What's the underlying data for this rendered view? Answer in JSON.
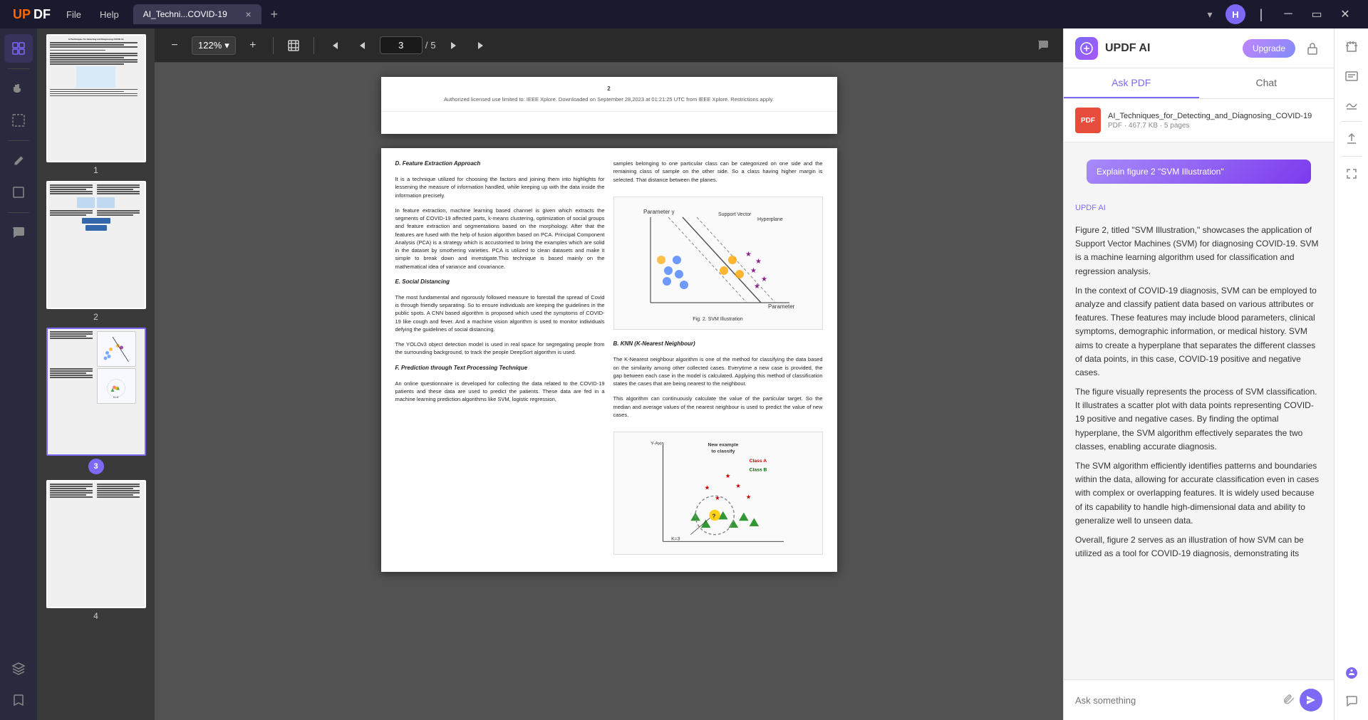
{
  "app": {
    "name": "UPDF",
    "logo_text": "UPDF"
  },
  "titlebar": {
    "file_menu": "File",
    "help_menu": "Help",
    "tab_title": "AI_Techni...COVID-19",
    "tab_close": "×",
    "tab_add": "+",
    "controls": {
      "dropdown": "▾",
      "user_avatar": "H",
      "minimize": "─",
      "maximize": "▭",
      "close": "✕"
    }
  },
  "toolbar": {
    "zoom_out": "−",
    "zoom_level": "122%",
    "zoom_dropdown": "▾",
    "zoom_in": "+",
    "fit_page": "⊡",
    "nav_first": "⏮",
    "nav_prev": "◀",
    "page_current": "3",
    "page_separator": "/",
    "page_total": "5",
    "nav_next": "▶",
    "nav_last": "⏭",
    "comment_icon": "💬"
  },
  "pdf": {
    "page2_header": "Authorized licensed use limited to: IEEE Xplore. Downloaded on September 28,2023 at 01:21:25 UTC from IEEE Xplore. Restrictions apply.",
    "page2_num": "2",
    "page3_sections": {
      "left_col": {
        "section_d_title": "D. Feature Extraction Approach",
        "section_d_para1": "It is a technique utilized for choosing the factors and joining them into highlights for lessening the measure of information handled, while keeping up with the data inside the information precisely.",
        "section_d_para2": "In feature extraction, machine learning based channel is given which extracts the segments of COVID-19 affected parts, k-means clustering, optimization of social groups and feature extraction and segmentations based on the morphology. After that the features are fused with the help of fusion algorithm based on PCA. Principal Component Analysis (PCA) is a strategy which is accustomed to bring the examples which are solid in the dataset by smothering varieties. PCA is utilized to clean datasets and make it simple to break down and investigate.This technique is based mainly on the mathematical idea of variance and covariance.",
        "section_e_title": "E. Social Distancing",
        "section_e_para1": "The most fundamental and rigorously followed measure to forestall the spread of Covid is through friendly separating. So to ensure individuals are keeping the guidelines in the public spots. A CNN based algorithm is proposed which used the symptoms of COVID-19 like cough and fever. And a machine vision algorithm is used to monitor individuals defying the guidelines of social distancing.",
        "section_e_para2": "The YOLOv3 object detection model is used in real space for segregating people from the surrounding background, to track the people DeepSort algorithm is used.",
        "section_f_title": "F. Prediction through Text Processing Technique",
        "section_f_para1": "An online questionnaire is developed for collecting the data related to the COVID-19 patients and these data are used to predict the patients. These data are fed in a machine learning prediction algorithms like SVM, logistic regression,"
      },
      "right_col": {
        "intro_para1": "samples belonging to one particular class can be categorized on one side and the remaining class of sample on the other side. So a class having higher margin is selected. That distance between the planes.",
        "fig2_caption": "Fig. 2. SVM Illustration",
        "section_b_title": "B. KNN (K-Nearest Neighbour)",
        "section_b_para1": "The K-Nearest neighbour algorithm is one of the method for classifying the data based on the similarity among other collected cases. Everytime a new case is provided, the gap between each case in the model is calculated. Applying this method of classification states the cases that are being nearest to the neighbour.",
        "section_b_para2": "This algorithm can continuously calculate the value of the particular target. So the median and average values of the nearest neighbour is used to predict the value of new cases.",
        "knn_caption": "New example to classify Class A Class B",
        "knn_label_k3": "K=3",
        "knn_yaxis": "Y-Axis"
      }
    }
  },
  "ai_panel": {
    "title": "UPDF AI",
    "upgrade_btn": "Upgrade",
    "tabs": {
      "ask_pdf": "Ask PDF",
      "chat": "Chat",
      "active": "ask_pdf"
    },
    "file": {
      "icon_text": "PDF",
      "name": "AI_Techniques_for_Detecting_and_Diagnosing_COVID-19",
      "meta": "PDF · 467.7 KB · 5 pages"
    },
    "suggest_btn": "Explain figure 2 \"SVM Illustration\"",
    "sender": "UPDF AI",
    "messages": [
      {
        "text": "Figure 2, titled \"SVM Illustration,\" showcases the application of Support Vector Machines (SVM) for diagnosing COVID-19. SVM is a machine learning algorithm used for classification and regression analysis."
      },
      {
        "text": "In the context of COVID-19 diagnosis, SVM can be employed to analyze and classify patient data based on various attributes or features. These features may include blood parameters, clinical symptoms, demographic information, or medical history. SVM aims to create a hyperplane that separates the different classes of data points, in this case, COVID-19 positive and negative cases."
      },
      {
        "text": "The figure visually represents the process of SVM classification. It illustrates a scatter plot with data points representing COVID-19 positive and negative cases. By finding the optimal hyperplane, the SVM algorithm effectively separates the two classes, enabling accurate diagnosis."
      },
      {
        "text": "The SVM algorithm efficiently identifies patterns and boundaries within the data, allowing for accurate classification even in cases with complex or overlapping features. It is widely used because of its capability to handle high-dimensional data and ability to generalize well to unseen data."
      },
      {
        "text": "Overall, figure 2 serves as an illustration of how SVM can be utilized as a tool for COVID-19 diagnosis, demonstrating its"
      }
    ],
    "input_placeholder": "Ask something"
  },
  "left_sidebar": {
    "icons": [
      {
        "name": "pages-icon",
        "symbol": "⊞",
        "active": true
      },
      {
        "name": "divider1",
        "type": "divider"
      },
      {
        "name": "hand-tool-icon",
        "symbol": "✋"
      },
      {
        "name": "select-icon",
        "symbol": "⬚"
      },
      {
        "name": "divider2",
        "type": "divider"
      },
      {
        "name": "annotation-icon",
        "symbol": "✎"
      },
      {
        "name": "shapes-icon",
        "symbol": "◻"
      },
      {
        "name": "divider3",
        "type": "divider"
      },
      {
        "name": "comment-icon",
        "symbol": "💬"
      },
      {
        "name": "redact-icon",
        "symbol": "▬"
      }
    ]
  },
  "right_sidebar": {
    "icons": [
      {
        "name": "convert-icon",
        "symbol": "⟳"
      },
      {
        "name": "ocr-icon",
        "symbol": "Aa"
      },
      {
        "name": "sign-icon",
        "symbol": "✒"
      },
      {
        "name": "divider1",
        "type": "divider"
      },
      {
        "name": "share-icon",
        "symbol": "↑"
      },
      {
        "name": "divider2",
        "type": "divider"
      },
      {
        "name": "compress-icon",
        "symbol": "⊟"
      },
      {
        "name": "chat-ai-icon",
        "symbol": "◈"
      }
    ]
  },
  "thumbnails": [
    {
      "page": 1,
      "label": "1",
      "active": false
    },
    {
      "page": 2,
      "label": "2",
      "active": false
    },
    {
      "page": 3,
      "label": "3",
      "active": true
    },
    {
      "page": 4,
      "label": "4",
      "active": false
    }
  ]
}
